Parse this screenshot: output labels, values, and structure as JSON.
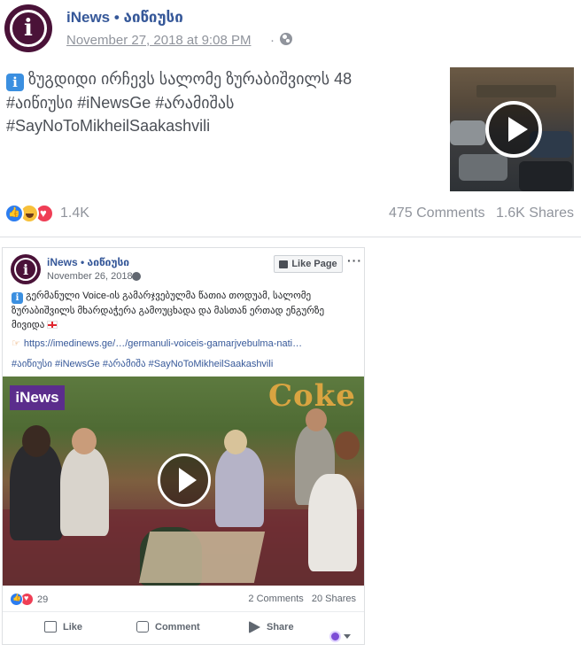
{
  "post": {
    "page_name": "iNews • აიწიუსი",
    "timestamp": "November 27, 2018 at 9:08 PM",
    "separator": "·",
    "text_line1": "ზუგდიდი ირჩევს სალომე ზურაბიშვილს 48",
    "text_line2": "#აიწიუსი #iNewsGe #არამიშას",
    "text_line3": "#SayNoToMikheilSaakashvili",
    "reactions_count": "1.4K",
    "comments": "475 Comments",
    "shares": "1.6K Shares"
  },
  "embed": {
    "page_name": "iNews • აიწიუსი",
    "timestamp": "November 26, 2018",
    "like_page_label": "Like Page",
    "more_label": "···",
    "text_line1": "გერმანული Voice-ის გამარჯვებულმა წათია თოდუამ, სალომე",
    "text_line2": "ზურაბიშვილს მხარდაჭერა გამოუცხადა და მასთან ერთად ენგურზე",
    "text_line3": "მივიდა",
    "link": "https://imedinews.ge/…/germanuli-voiceis-gamarjvebulma-nati…",
    "tags": "#აიწიუსი #iNewsGe #არამიშა #SayNoToMikheilSaakashvili",
    "video_logo": "iNews",
    "video_sign": "Coke",
    "reactions_count": "29",
    "comments": "2 Comments",
    "shares": "20 Shares",
    "actions": {
      "like": "Like",
      "comment": "Comment",
      "share": "Share"
    }
  },
  "colors": {
    "link_blue": "#365899",
    "brand_purple": "#4a1238",
    "meta_gray": "#90949c"
  },
  "icons": [
    "info-icon",
    "globe-icon",
    "play-icon",
    "like-icon",
    "comment-icon",
    "share-icon"
  ]
}
